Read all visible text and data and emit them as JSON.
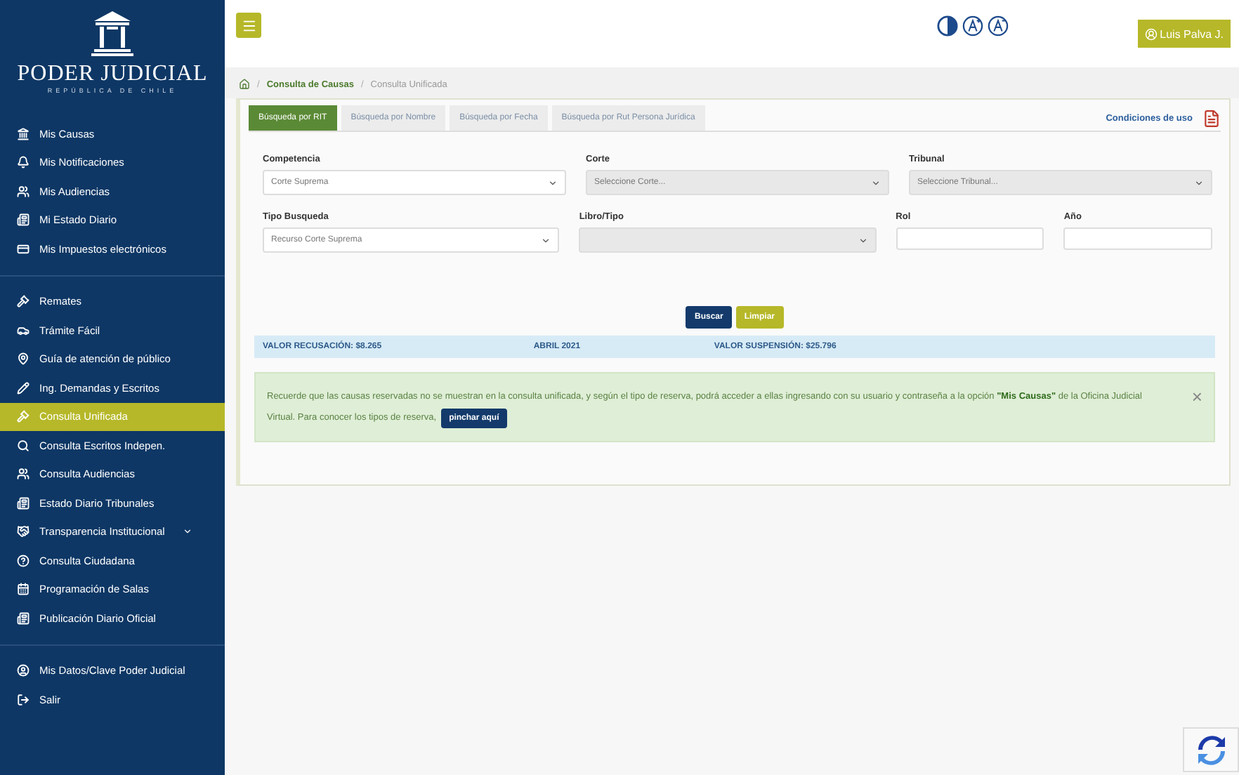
{
  "logo": {
    "title": "PODER JUDICIAL",
    "subtitle": "REPÚBLICA DE CHILE"
  },
  "sidebar": {
    "groups": [
      {
        "items": [
          {
            "label": "Mis Causas",
            "selected": false
          },
          {
            "label": "Mis Notificaciones",
            "selected": false
          },
          {
            "label": "Mis Audiencias",
            "selected": false
          },
          {
            "label": "Mi Estado Diario",
            "selected": false
          },
          {
            "label": "Mis Impuestos electrónicos",
            "selected": false
          }
        ]
      },
      {
        "items": [
          {
            "label": "Remates",
            "selected": false
          },
          {
            "label": "Trámite Fácil",
            "selected": false
          },
          {
            "label": "Guía de atención de público",
            "selected": false
          },
          {
            "label": "Ing. Demandas y Escritos",
            "selected": false
          },
          {
            "label": "Consulta Unificada",
            "selected": true
          },
          {
            "label": "Consulta Escritos Indepen.",
            "selected": false
          },
          {
            "label": "Consulta Audiencias",
            "selected": false
          },
          {
            "label": "Estado Diario Tribunales",
            "selected": false
          },
          {
            "label": "Transparencia Institucional",
            "selected": false,
            "submenu": true
          },
          {
            "label": "Consulta Ciudadana",
            "selected": false
          },
          {
            "label": "Programación de Salas",
            "selected": false
          },
          {
            "label": "Publicación Diario Oficial",
            "selected": false
          }
        ]
      },
      {
        "items": [
          {
            "label": "Mis Datos/Clave Poder Judicial",
            "selected": false
          },
          {
            "label": "Salir",
            "selected": false
          }
        ]
      }
    ]
  },
  "topbar": {
    "user": "Luis Palva J."
  },
  "breadcrumb": [
    {
      "kind": "separator",
      "text": "/"
    },
    {
      "kind": "link",
      "text": "Consulta de Causas"
    },
    {
      "kind": "separator",
      "text": "/"
    },
    {
      "kind": "current",
      "text": "Consulta Unificada"
    }
  ],
  "tabs": [
    {
      "label": "Búsqueda por RIT",
      "selected": true
    },
    {
      "label": "Búsqueda por Nombre",
      "selected": false
    },
    {
      "label": "Búsqueda por Fecha",
      "selected": false
    },
    {
      "label": "Búsqueda por Rut Persona Jurídica",
      "selected": false
    }
  ],
  "terms_link": "Condiciones de uso",
  "form_rows": [
    [
      {
        "label": "Competencia",
        "kind": "select",
        "value": "Corte Suprema",
        "disabled": false
      },
      {
        "label": "Corte",
        "kind": "select",
        "value": "Seleccione Corte...",
        "disabled": true
      },
      {
        "label": "Tribunal",
        "kind": "select",
        "value": "Seleccione Tribunal...",
        "disabled": true
      }
    ],
    [
      {
        "label": "Tipo Busqueda",
        "kind": "select",
        "value": "Recurso Corte Suprema",
        "disabled": false
      },
      {
        "label": "Libro/Tipo",
        "kind": "select",
        "disabled": true
      },
      {
        "label": "Rol",
        "kind": "input"
      },
      {
        "label": "Año",
        "kind": "input"
      }
    ]
  ],
  "buttons": [
    {
      "label": "Buscar",
      "kind": "primary"
    },
    {
      "label": "Limpiar",
      "kind": "secondary"
    }
  ],
  "info_bar": [
    "VALOR RECUSACIÓN: $8.265",
    "ABRIL 2021",
    "VALOR SUSPENSIÓN: $25.796"
  ],
  "alert": {
    "text": "Recuerde que las causas reservadas no se muestran en la consulta unificada, y según el tipo de reserva, podrá acceder a ellas ingresando con su usuario y contraseña a la opción **\"Mis Causas\"** de la Oficina Judicial Virtual. Para conocer los tipos de reserva,",
    "button": "pinchar aquí",
    "close": "×"
  }
}
